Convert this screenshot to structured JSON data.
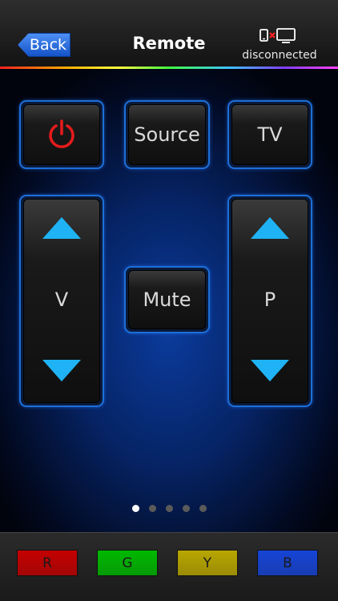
{
  "navbar": {
    "back_label": "Back",
    "title": "Remote",
    "connection_status": "disconnected",
    "connection_icon": "device-disconnected-icon"
  },
  "remote": {
    "power_icon": "power-icon",
    "source_label": "Source",
    "tv_label": "TV",
    "volume": {
      "up_icon": "triangle-up-icon",
      "label": "V",
      "down_icon": "triangle-down-icon"
    },
    "mute_label": "Mute",
    "program": {
      "up_icon": "triangle-up-icon",
      "label": "P",
      "down_icon": "triangle-down-icon"
    }
  },
  "page_indicator": {
    "total": 5,
    "current": 1
  },
  "color_buttons": [
    {
      "label": "R",
      "color": "#c40000"
    },
    {
      "label": "G",
      "color": "#00b800"
    },
    {
      "label": "Y",
      "color": "#b8a600"
    },
    {
      "label": "B",
      "color": "#1644d6"
    }
  ],
  "colors": {
    "accent": "#1fb3f5",
    "power": "#e41b1b",
    "nav_back": "#2a6fe0",
    "button_border": "#1c6fd8"
  }
}
